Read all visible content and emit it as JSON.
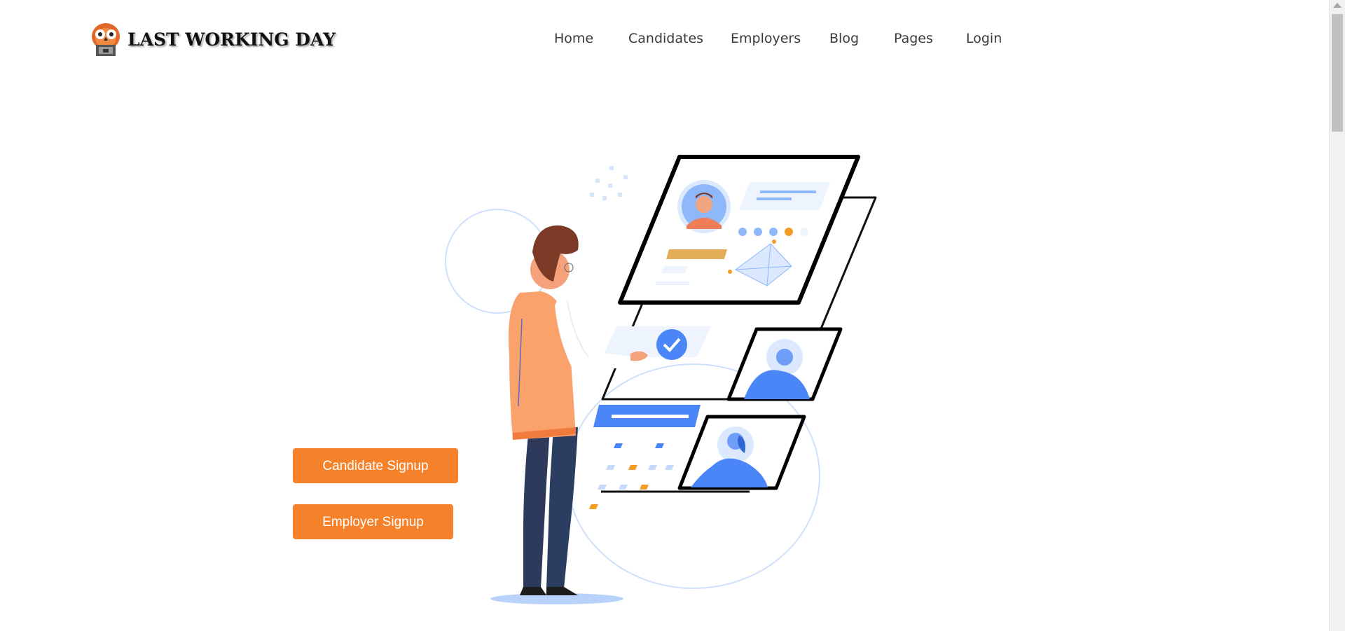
{
  "brand": {
    "name": "LAST WORKING DAY",
    "logo_icon": "owl-mascot-icon"
  },
  "nav": {
    "items": [
      {
        "label": "Home"
      },
      {
        "label": "Candidates"
      },
      {
        "label": "Employers"
      },
      {
        "label": "Blog"
      },
      {
        "label": "Pages"
      },
      {
        "label": "Login"
      }
    ]
  },
  "hero": {
    "buttons": {
      "candidate_signup": "Candidate Signup",
      "employer_signup": "Employer Signup"
    },
    "illustration": "person-selecting-candidate-profiles-illustration"
  },
  "colors": {
    "accent": "#f5822a",
    "illustration_blue": "#4a86f7",
    "illustration_light_blue": "#a9c9fb",
    "shirt": "#f9a26c",
    "pants": "#2b3a5e"
  }
}
